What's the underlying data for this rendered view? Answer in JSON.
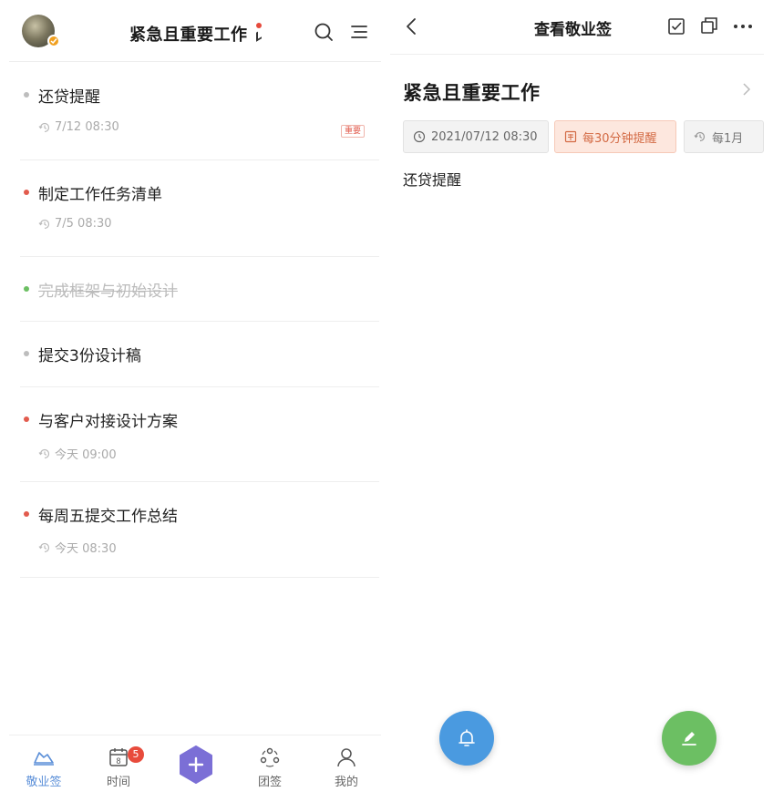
{
  "left": {
    "header": {
      "title": "紧急且重要工作"
    },
    "items": [
      {
        "text": "还贷提醒",
        "meta": "7/12 08:30",
        "tag": "重要",
        "dot_color": "#bdbdbd",
        "done": false
      },
      {
        "text": "制定工作任务清单",
        "meta": "7/5 08:30",
        "tag": "",
        "dot_color": "#e25b4d",
        "done": false
      },
      {
        "text": "完成框架与初始设计",
        "meta": "",
        "tag": "",
        "dot_color": "#6cbf63",
        "done": true
      },
      {
        "text": "提交3份设计稿",
        "meta": "",
        "tag": "",
        "dot_color": "#bdbdbd",
        "done": false
      },
      {
        "text": "与客户对接设计方案",
        "meta": "今天 09:00",
        "tag": "",
        "dot_color": "#e25b4d",
        "done": false
      },
      {
        "text": "每周五提交工作总结",
        "meta": "今天 08:30",
        "tag": "",
        "dot_color": "#e25b4d",
        "done": false
      }
    ],
    "tabbar": {
      "tabs": [
        {
          "label": "敬业签",
          "icon": "boat-icon",
          "active": true
        },
        {
          "label": "时间",
          "icon": "calendar-icon",
          "active": false,
          "badge": "5",
          "calendar_day": "8"
        },
        {
          "label": "",
          "icon": "add-icon",
          "active": false
        },
        {
          "label": "团签",
          "icon": "team-icon",
          "active": false
        },
        {
          "label": "我的",
          "icon": "profile-icon",
          "active": false
        }
      ]
    }
  },
  "right": {
    "header": {
      "title": "查看敬业签"
    },
    "note": {
      "title": "紧急且重要工作",
      "chips": {
        "time": "2021/07/12 08:30",
        "remind": "每30分钟提醒",
        "repeat": "每1月"
      },
      "body": "还贷提醒"
    }
  },
  "colors": {
    "accent_blue": "#5b8fd8",
    "fab_blue": "#4a9ae0",
    "fab_green": "#6cbf63",
    "important_red": "#e25b4d",
    "add_purple": "#7b6fd6"
  }
}
